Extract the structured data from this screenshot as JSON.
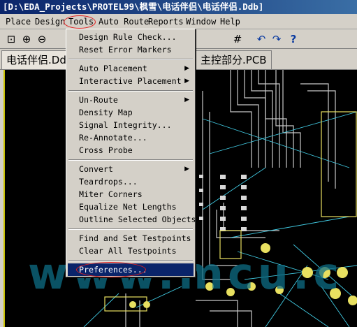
{
  "window": {
    "title": "[D:\\EDA_Projects\\PROTEL99\\枫雪\\电话伴侣\\电话伴侣.Ddb]"
  },
  "menubar": {
    "items": [
      "Place",
      "Design",
      "Tools",
      "Auto Route",
      "Reports",
      "Window",
      "Help"
    ],
    "open": "Tools"
  },
  "toolbar": {
    "icons": [
      "zoom-fit-icon",
      "zoom-in-icon",
      "zoom-out-icon",
      "grid-icon",
      "undo-icon",
      "redo-icon",
      "help-icon"
    ]
  },
  "tabs": [
    {
      "label": "电话伴侣.Ddb"
    },
    {
      "label": "主控部分.PCB"
    }
  ],
  "watermark": "www.mcu.c",
  "tools_menu": {
    "items": [
      {
        "label": "Design Rule Check...",
        "submenu": false
      },
      {
        "label": "Reset Error Markers",
        "submenu": false
      },
      {
        "label": "Auto Placement",
        "submenu": true
      },
      {
        "label": "Interactive Placement",
        "submenu": true
      },
      {
        "label": "Un-Route",
        "submenu": true
      },
      {
        "label": "Density Map",
        "submenu": false
      },
      {
        "label": "Signal Integrity...",
        "submenu": false
      },
      {
        "label": "Re-Annotate...",
        "submenu": false
      },
      {
        "label": "Cross Probe",
        "submenu": false
      },
      {
        "label": "Convert",
        "submenu": true
      },
      {
        "label": "Teardrops...",
        "submenu": false
      },
      {
        "label": "Miter Corners",
        "submenu": false
      },
      {
        "label": "Equalize Net Lengths",
        "submenu": false
      },
      {
        "label": "Outline Selected Objects",
        "submenu": false
      },
      {
        "label": "Find and Set Testpoints",
        "submenu": false
      },
      {
        "label": "Clear All Testpoints",
        "submenu": false
      },
      {
        "label": "Preferences...",
        "submenu": false
      }
    ],
    "selected": "Preferences...",
    "submenu_arrow": "▶"
  },
  "colors": {
    "title_bar": "#0a246a",
    "menu_face": "#d4d0c8",
    "selection": "#0a246a",
    "annotation": "#e02020",
    "pcb_background": "#000000",
    "pcb_track": "#c8c8c8",
    "pcb_ratsnest": "#40c8e0",
    "pcb_pad": "#e8e060"
  }
}
